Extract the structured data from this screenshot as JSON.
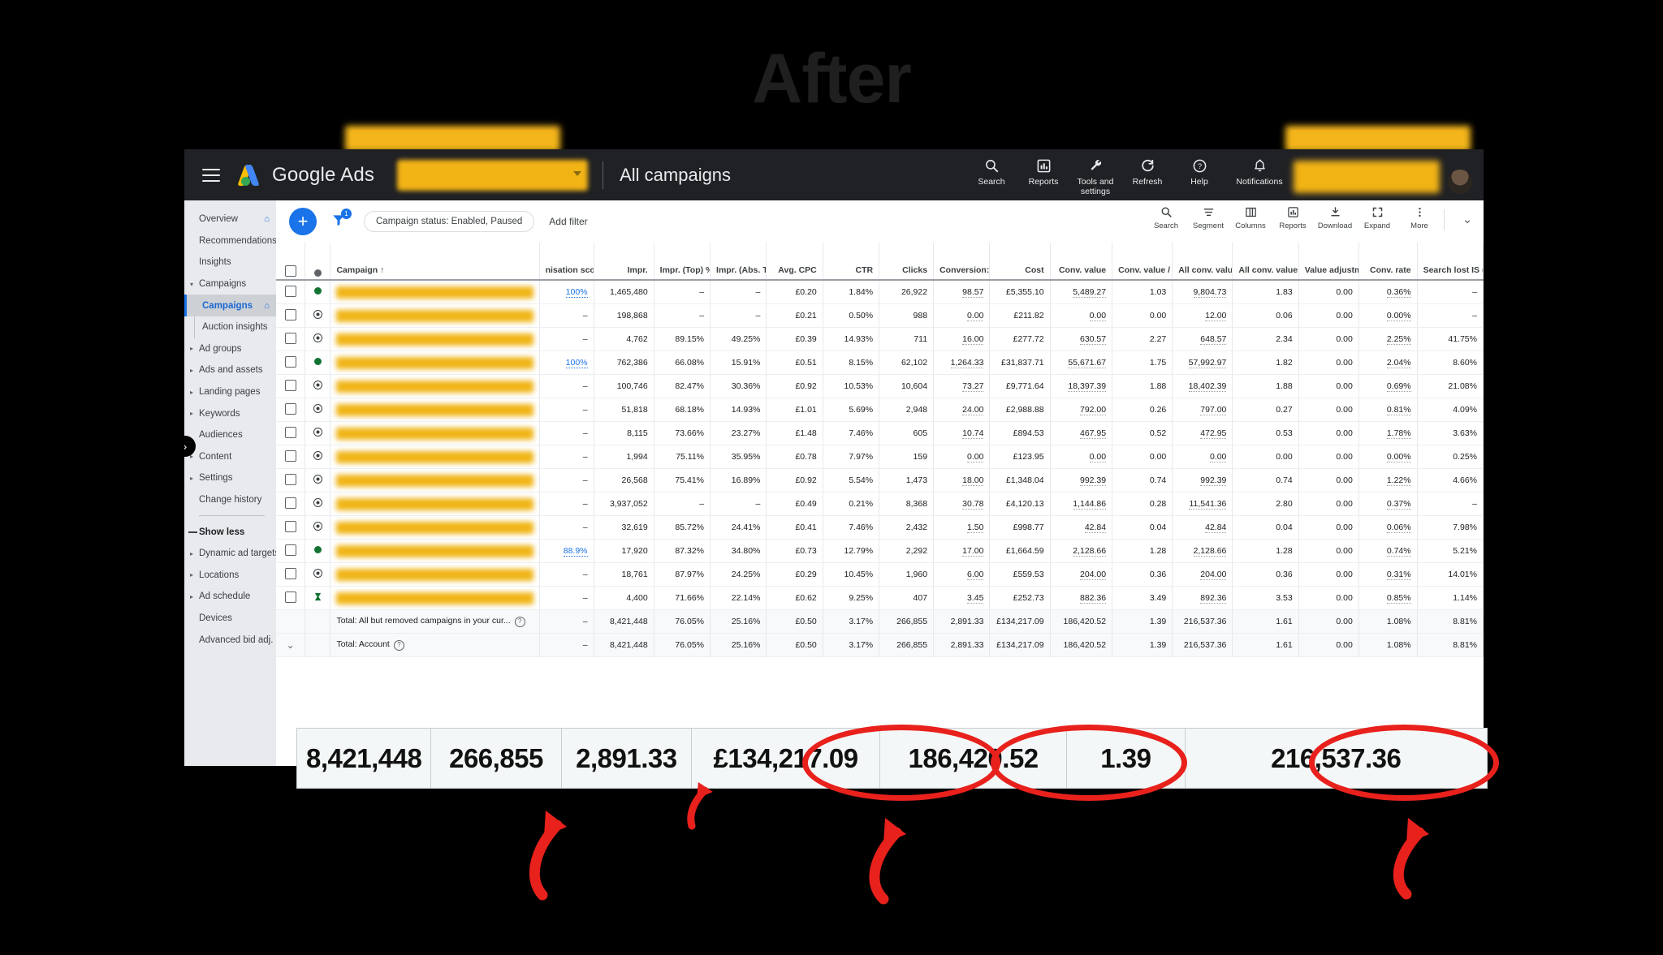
{
  "title": "After",
  "window": {
    "brand": "Google Ads",
    "page_title": "All campaigns",
    "top_icons": [
      {
        "name": "search",
        "label": "Search",
        "glyph": "⌕"
      },
      {
        "name": "reports",
        "label": "Reports",
        "glyph": "ὌA"
      },
      {
        "name": "tools-and-settings",
        "label": "Tools and settings",
        "glyph": "🔧"
      },
      {
        "name": "refresh",
        "label": "Refresh",
        "glyph": "⟳"
      },
      {
        "name": "help",
        "label": "Help",
        "glyph": "?"
      },
      {
        "name": "notifications",
        "label": "Notifications",
        "glyph": "🔔"
      }
    ]
  },
  "sidebar": {
    "items": [
      {
        "label": "Overview",
        "arrow": "",
        "home": true,
        "active": false,
        "sub": false
      },
      {
        "label": "Recommendations",
        "arrow": "",
        "home": false,
        "active": false,
        "sub": false
      },
      {
        "label": "Insights",
        "arrow": "",
        "home": false,
        "active": false,
        "sub": false
      },
      {
        "label": "Campaigns",
        "arrow": "▾",
        "home": false,
        "active": false,
        "sub": false
      },
      {
        "label": "Campaigns",
        "arrow": "",
        "home": true,
        "active": true,
        "sub": true
      },
      {
        "label": "Auction insights",
        "arrow": "",
        "home": false,
        "active": false,
        "sub": true
      },
      {
        "label": "Ad groups",
        "arrow": "▸",
        "home": false,
        "active": false,
        "sub": false
      },
      {
        "label": "Ads and assets",
        "arrow": "▸",
        "home": false,
        "active": false,
        "sub": false
      },
      {
        "label": "Landing pages",
        "arrow": "▸",
        "home": false,
        "active": false,
        "sub": false
      },
      {
        "label": "Keywords",
        "arrow": "▸",
        "home": false,
        "active": false,
        "sub": false
      },
      {
        "label": "Audiences",
        "arrow": "",
        "home": false,
        "active": false,
        "sub": false
      },
      {
        "label": "Content",
        "arrow": "▸",
        "home": false,
        "active": false,
        "sub": false
      },
      {
        "label": "Settings",
        "arrow": "▸",
        "home": false,
        "active": false,
        "sub": false
      },
      {
        "label": "Change history",
        "arrow": "",
        "home": false,
        "active": false,
        "sub": false
      }
    ],
    "show_less": "Show less",
    "items2": [
      {
        "label": "Dynamic ad targets",
        "arrow": "▸"
      },
      {
        "label": "Locations",
        "arrow": "▸"
      },
      {
        "label": "Ad schedule",
        "arrow": "▸"
      },
      {
        "label": "Devices",
        "arrow": ""
      },
      {
        "label": "Advanced bid adj.",
        "arrow": ""
      }
    ]
  },
  "toolbar": {
    "filter_chip": "Campaign status: Enabled, Paused",
    "add_filter": "Add filter",
    "tools": [
      {
        "name": "search",
        "label": "Search",
        "glyph": "⌕"
      },
      {
        "name": "segment",
        "label": "Segment",
        "glyph": "≡"
      },
      {
        "name": "columns",
        "label": "Columns",
        "glyph": "▦"
      },
      {
        "name": "reports",
        "label": "Reports",
        "glyph": "📊"
      },
      {
        "name": "download",
        "label": "Download",
        "glyph": "⬇"
      },
      {
        "name": "expand",
        "label": "Expand",
        "glyph": "⛶"
      },
      {
        "name": "more",
        "label": "More",
        "glyph": "⋮"
      }
    ],
    "filter_badge": "1"
  },
  "table": {
    "headers": [
      "Campaign ↑",
      "nisation score",
      "Impr.",
      "Impr. (Top) %",
      "Impr. (Abs. Top) %",
      "Avg. CPC",
      "CTR",
      "Clicks",
      "Conversion:",
      "Cost",
      "Conv. value",
      "Conv. value / cost",
      "All conv. value",
      "All conv. value / cost",
      "Value adjustment",
      "Conv. rate",
      "Search lost IS (budget)"
    ],
    "rows": [
      {
        "status": "green",
        "score": "100%",
        "score_link": true,
        "cells": [
          "1,465,480",
          "–",
          "–",
          "£0.20",
          "1.84%",
          "26,922",
          "98.57",
          "£5,355.10",
          "5,489.27",
          "1.03",
          "9,804.73",
          "1.83",
          "0.00",
          "0.36%",
          "–"
        ]
      },
      {
        "status": "greyring",
        "score": "–",
        "score_link": false,
        "cells": [
          "198,868",
          "–",
          "–",
          "£0.21",
          "0.50%",
          "988",
          "0.00",
          "£211.82",
          "0.00",
          "0.00",
          "12.00",
          "0.06",
          "0.00",
          "0.00%",
          "–"
        ]
      },
      {
        "status": "greyring",
        "score": "–",
        "score_link": false,
        "cells": [
          "4,762",
          "89.15%",
          "49.25%",
          "£0.39",
          "14.93%",
          "711",
          "16.00",
          "£277.72",
          "630.57",
          "2.27",
          "648.57",
          "2.34",
          "0.00",
          "2.25%",
          "41.75%"
        ]
      },
      {
        "status": "green",
        "score": "100%",
        "score_link": true,
        "cells": [
          "762,386",
          "66.08%",
          "15.91%",
          "£0.51",
          "8.15%",
          "62,102",
          "1,264.33",
          "£31,837.71",
          "55,671.67",
          "1.75",
          "57,992.97",
          "1.82",
          "0.00",
          "2.04%",
          "8.60%"
        ]
      },
      {
        "status": "greyring",
        "score": "–",
        "score_link": false,
        "cells": [
          "100,746",
          "82.47%",
          "30.36%",
          "£0.92",
          "10.53%",
          "10,604",
          "73.27",
          "£9,771.64",
          "18,397.39",
          "1.88",
          "18,402.39",
          "1.88",
          "0.00",
          "0.69%",
          "21.08%"
        ]
      },
      {
        "status": "greyring",
        "score": "–",
        "score_link": false,
        "cells": [
          "51,818",
          "68.18%",
          "14.93%",
          "£1.01",
          "5.69%",
          "2,948",
          "24.00",
          "£2,988.88",
          "792.00",
          "0.26",
          "797.00",
          "0.27",
          "0.00",
          "0.81%",
          "4.09%"
        ]
      },
      {
        "status": "greyring",
        "score": "–",
        "score_link": false,
        "cells": [
          "8,115",
          "73.66%",
          "23.27%",
          "£1.48",
          "7.46%",
          "605",
          "10.74",
          "£894.53",
          "467.95",
          "0.52",
          "472.95",
          "0.53",
          "0.00",
          "1.78%",
          "3.63%"
        ]
      },
      {
        "status": "greyring",
        "score": "–",
        "score_link": false,
        "cells": [
          "1,994",
          "75.11%",
          "35.95%",
          "£0.78",
          "7.97%",
          "159",
          "0.00",
          "£123.95",
          "0.00",
          "0.00",
          "0.00",
          "0.00",
          "0.00",
          "0.00%",
          "0.25%"
        ]
      },
      {
        "status": "greyring",
        "score": "–",
        "score_link": false,
        "cells": [
          "26,568",
          "75.41%",
          "16.89%",
          "£0.92",
          "5.54%",
          "1,473",
          "18.00",
          "£1,348.04",
          "992.39",
          "0.74",
          "992.39",
          "0.74",
          "0.00",
          "1.22%",
          "4.66%"
        ]
      },
      {
        "status": "greyring",
        "score": "–",
        "score_link": false,
        "cells": [
          "3,937,052",
          "–",
          "–",
          "£0.49",
          "0.21%",
          "8,368",
          "30.78",
          "£4,120.13",
          "1,144.86",
          "0.28",
          "11,541.36",
          "2.80",
          "0.00",
          "0.37%",
          "–"
        ]
      },
      {
        "status": "greyring",
        "score": "–",
        "score_link": false,
        "cells": [
          "32,619",
          "85.72%",
          "24.41%",
          "£0.41",
          "7.46%",
          "2,432",
          "1.50",
          "£998.77",
          "42.84",
          "0.04",
          "42.84",
          "0.04",
          "0.00",
          "0.06%",
          "7.98%"
        ]
      },
      {
        "status": "green",
        "score": "88.9%",
        "score_link": true,
        "cells": [
          "17,920",
          "87.32%",
          "34.80%",
          "£0.73",
          "12.79%",
          "2,292",
          "17.00",
          "£1,664.59",
          "2,128.66",
          "1.28",
          "2,128.66",
          "1.28",
          "0.00",
          "0.74%",
          "5.21%"
        ]
      },
      {
        "status": "greyring",
        "score": "–",
        "score_link": false,
        "cells": [
          "18,761",
          "87.97%",
          "24.25%",
          "£0.29",
          "10.45%",
          "1,960",
          "6.00",
          "£559.53",
          "204.00",
          "0.36",
          "204.00",
          "0.36",
          "0.00",
          "0.31%",
          "14.01%"
        ]
      },
      {
        "status": "paused",
        "score": "–",
        "score_link": false,
        "cells": [
          "4,400",
          "71.66%",
          "22.14%",
          "£0.62",
          "9.25%",
          "407",
          "3.45",
          "£252.73",
          "882.36",
          "3.49",
          "892.36",
          "3.53",
          "0.00",
          "0.85%",
          "1.14%"
        ]
      }
    ],
    "total_rows": [
      {
        "label": "Total: All but removed campaigns in your cur...",
        "chevron": false,
        "cells": [
          "–",
          "8,421,448",
          "76.05%",
          "25.16%",
          "£0.50",
          "3.17%",
          "266,855",
          "2,891.33",
          "£134,217.09",
          "186,420.52",
          "1.39",
          "216,537.36",
          "1.61",
          "0.00",
          "1.08%",
          "8.81%"
        ]
      },
      {
        "label": "Total: Account",
        "chevron": true,
        "cells": [
          "–",
          "8,421,448",
          "76.05%",
          "25.16%",
          "£0.50",
          "3.17%",
          "266,855",
          "2,891.33",
          "£134,217.09",
          "186,420.52",
          "1.39",
          "216,537.36",
          "1.61",
          "0.00",
          "1.08%",
          "8.81%"
        ]
      }
    ]
  },
  "callout": {
    "values": [
      "8,421,448",
      "266,855",
      "2,891.33",
      "£134,217.09",
      "186,420.52",
      "1.39",
      "216,537.36"
    ]
  },
  "colors": {
    "accent_blue": "#1a73e8",
    "highlight_yellow": "#f2b315",
    "annotation_red": "#e8211c",
    "status_green": "#137333",
    "topbar_dark": "#202124"
  }
}
